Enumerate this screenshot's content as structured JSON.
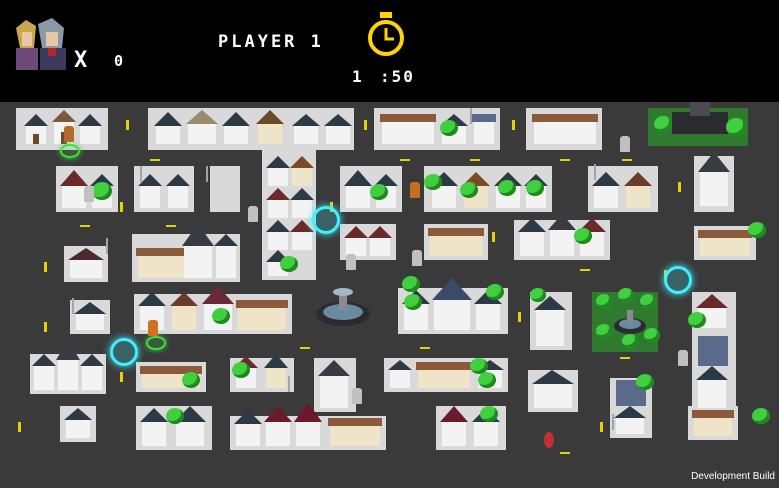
{
  "hud": {
    "lives_symbol": "X",
    "lives_count": "0",
    "player_label": "PLAYER 1",
    "timer_minutes": "1",
    "timer_seconds": ":50",
    "icons": [
      "character-portrait-icon",
      "stopwatch-icon"
    ],
    "accent_color": "#ffd400"
  },
  "watermark": "Development Build",
  "colors": {
    "road": "#3a3a3a",
    "block": "#d9d9d9",
    "lane_marking": "#e6d200",
    "portal": "#3ff0ff",
    "tree": "#3fcf3f"
  }
}
